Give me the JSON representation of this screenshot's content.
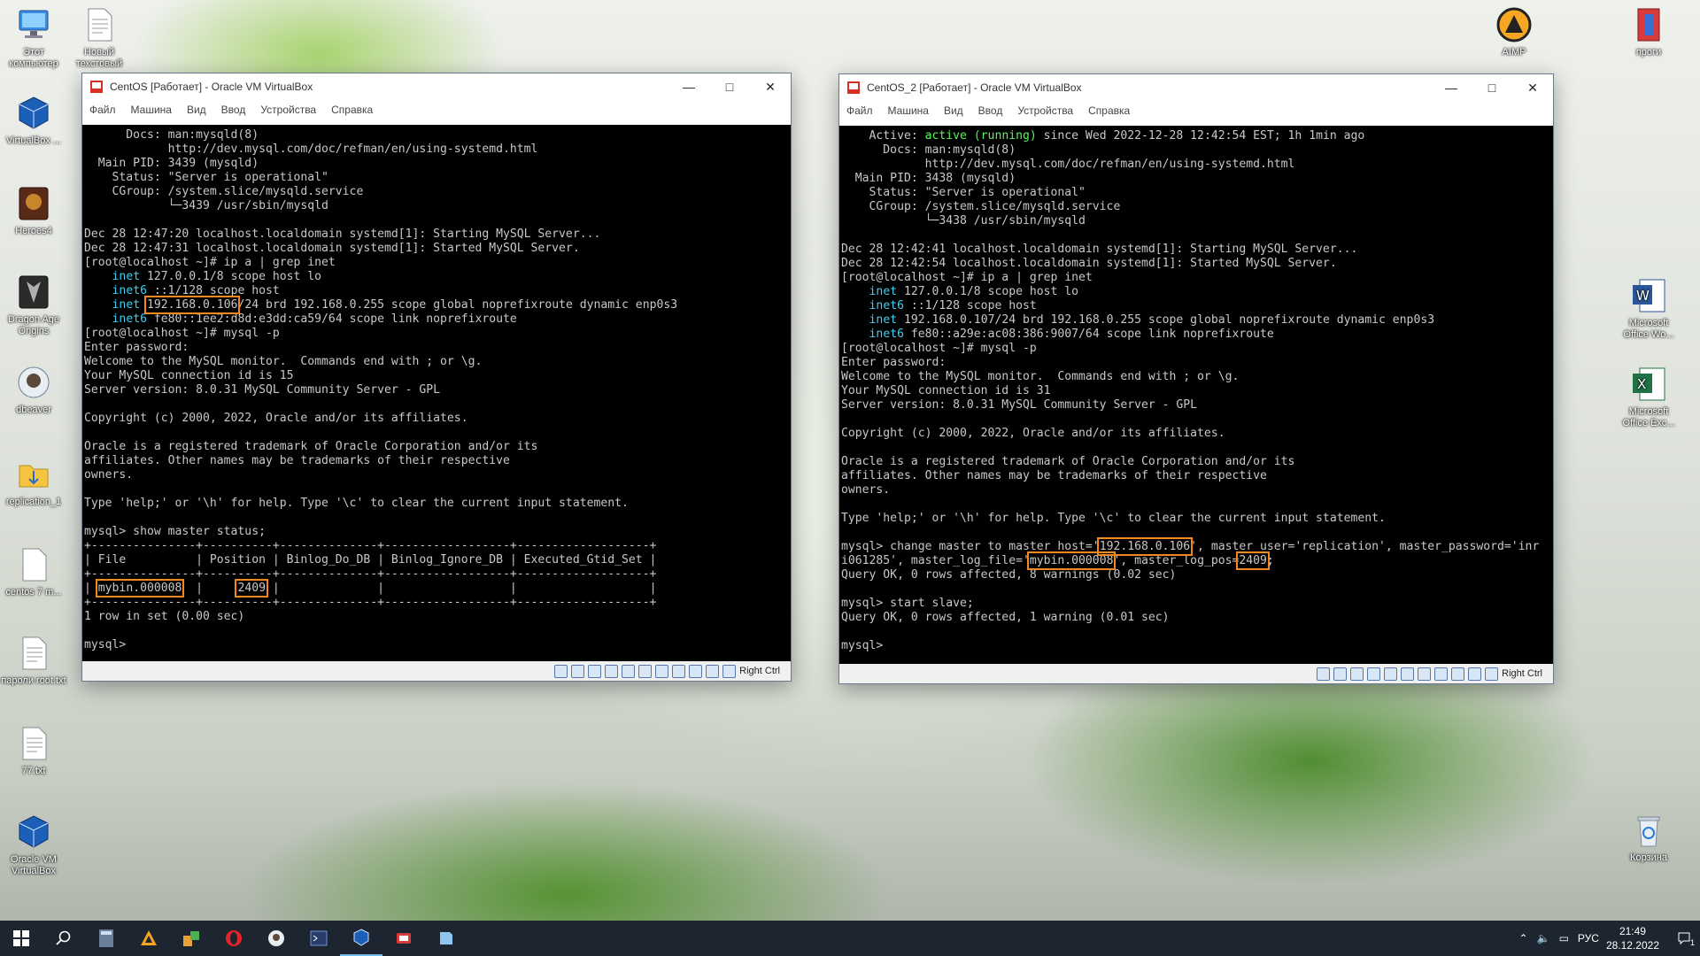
{
  "desktop_icons": [
    {
      "label": "Этот компьютер",
      "icon": "computer-icon"
    },
    {
      "label": "Новый текстовый",
      "icon": "text-file-icon"
    },
    {
      "label": "VirtualBox ...",
      "icon": "virtualbox-icon"
    },
    {
      "label": "Heroes4",
      "icon": "game-icon"
    },
    {
      "label": "Dragon Age Origins",
      "icon": "dragon-age-icon"
    },
    {
      "label": "dbeaver",
      "icon": "dbeaver-icon"
    },
    {
      "label": "replication_1",
      "icon": "folder-icon"
    },
    {
      "label": "centos 7 m...",
      "icon": "text-file-icon"
    },
    {
      "label": "пароли root.txt",
      "icon": "text-file-icon"
    },
    {
      "label": "77.txt",
      "icon": "text-file-icon"
    },
    {
      "label": "Oracle VM VirtualBox",
      "icon": "virtualbox-icon"
    },
    {
      "label": "AIMP",
      "icon": "aimp-icon"
    },
    {
      "label": "проги",
      "icon": "folder-icon"
    },
    {
      "label": "Microsoft Office Wo...",
      "icon": "word-icon"
    },
    {
      "label": "Microsoft Office Exc...",
      "icon": "excel-icon"
    },
    {
      "label": "Корзина",
      "icon": "recycle-bin-icon"
    }
  ],
  "menu": [
    "Файл",
    "Машина",
    "Вид",
    "Ввод",
    "Устройства",
    "Справка"
  ],
  "host_key": "Right Ctrl",
  "vm1": {
    "title": "CentOS [Работает] - Oracle VM VirtualBox",
    "lines": [
      "      Docs: man:mysqld(8)",
      "            http://dev.mysql.com/doc/refman/en/using-systemd.html",
      "  Main PID: 3439 (mysqld)",
      "    Status: \"Server is operational\"",
      "    CGroup: /system.slice/mysqld.service",
      "            └─3439 /usr/sbin/mysqld",
      "",
      "Dec 28 12:47:20 localhost.localdomain systemd[1]: Starting MySQL Server...",
      "Dec 28 12:47:31 localhost.localdomain systemd[1]: Started MySQL Server.",
      "[root@localhost ~]# ip a | grep inet",
      "    inet 127.0.0.1/8 scope host lo",
      "    inet6 ::1/128 scope host",
      "    inet 192.168.0.106/24 brd 192.168.0.255 scope global noprefixroute dynamic enp0s3",
      "    inet6 fe80::1ee2:d8d:e3dd:ca59/64 scope link noprefixroute",
      "[root@localhost ~]# mysql -p",
      "Enter password:",
      "Welcome to the MySQL monitor.  Commands end with ; or \\g.",
      "Your MySQL connection id is 15",
      "Server version: 8.0.31 MySQL Community Server - GPL",
      "",
      "Copyright (c) 2000, 2022, Oracle and/or its affiliates.",
      "",
      "Oracle is a registered trademark of Oracle Corporation and/or its",
      "affiliates. Other names may be trademarks of their respective",
      "owners.",
      "",
      "Type 'help;' or '\\h' for help. Type '\\c' to clear the current input statement.",
      "",
      "mysql> show master status;",
      "+---------------+----------+--------------+------------------+-------------------+",
      "| File          | Position | Binlog_Do_DB | Binlog_Ignore_DB | Executed_Gtid_Set |",
      "+---------------+----------+--------------+------------------+-------------------+",
      "| mybin.000008  |     2409 |              |                  |                   |",
      "+---------------+----------+--------------+------------------+-------------------+",
      "1 row in set (0.00 sec)",
      "",
      "mysql> "
    ]
  },
  "vm2": {
    "title": "CentOS_2 [Работает] - Oracle VM VirtualBox",
    "lines": [
      "    Active: active (running) since Wed 2022-12-28 12:42:54 EST; 1h 1min ago",
      "      Docs: man:mysqld(8)",
      "            http://dev.mysql.com/doc/refman/en/using-systemd.html",
      "  Main PID: 3438 (mysqld)",
      "    Status: \"Server is operational\"",
      "    CGroup: /system.slice/mysqld.service",
      "            └─3438 /usr/sbin/mysqld",
      "",
      "Dec 28 12:42:41 localhost.localdomain systemd[1]: Starting MySQL Server...",
      "Dec 28 12:42:54 localhost.localdomain systemd[1]: Started MySQL Server.",
      "[root@localhost ~]# ip a | grep inet",
      "    inet 127.0.0.1/8 scope host lo",
      "    inet6 ::1/128 scope host",
      "    inet 192.168.0.107/24 brd 192.168.0.255 scope global noprefixroute dynamic enp0s3",
      "    inet6 fe80::a29e:ac08:386:9007/64 scope link noprefixroute",
      "[root@localhost ~]# mysql -p",
      "Enter password:",
      "Welcome to the MySQL monitor.  Commands end with ; or \\g.",
      "Your MySQL connection id is 31",
      "Server version: 8.0.31 MySQL Community Server - GPL",
      "",
      "Copyright (c) 2000, 2022, Oracle and/or its affiliates.",
      "",
      "Oracle is a registered trademark of Oracle Corporation and/or its",
      "affiliates. Other names may be trademarks of their respective",
      "owners.",
      "",
      "Type 'help;' or '\\h' for help. Type '\\c' to clear the current input statement.",
      "",
      "mysql> change master to master_host='192.168.0.106', master_user='replication', master_password='inr",
      "i061285', master_log_file='mybin.000008', master_log_pos=2409;",
      "Query OK, 0 rows affected, 8 warnings (0.02 sec)",
      "",
      "mysql> start slave;",
      "Query OK, 0 rows affected, 1 warning (0.01 sec)",
      "",
      "mysql> "
    ]
  },
  "taskbar": {
    "items": [
      "start-icon",
      "search-icon",
      "calculator-icon",
      "aimp-icon",
      "app-icon",
      "opera-icon",
      "dbeaver-icon",
      "terminal-icon",
      "virtualbox-icon",
      "files-icon",
      "notes-icon"
    ],
    "lang": "РУС",
    "time": "21:49",
    "date": "28.12.2022",
    "notif_count": "1"
  }
}
